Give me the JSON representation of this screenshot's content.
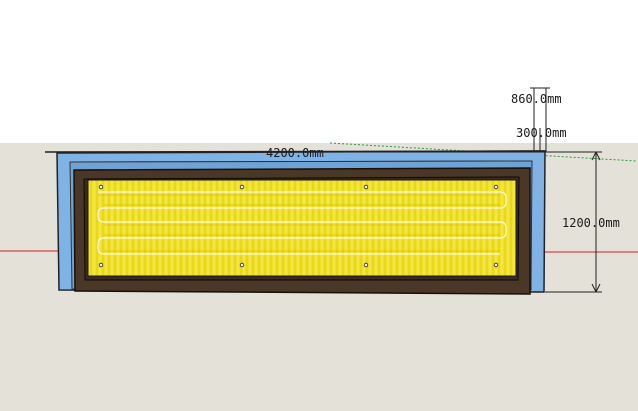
{
  "dimensions": {
    "length": "4200.0mm",
    "height": "1200.0mm",
    "edge_offset": "860.0mm",
    "wall_thickness": "300.0mm"
  },
  "colors": {
    "sky": "#ffffff",
    "ground": "#e3e1d8",
    "wall": "#7fb3e6",
    "trench": "#4a3727",
    "panel": "#f2e12a",
    "red_axis": "#d32020",
    "green_axis": "#2c9b3e"
  }
}
